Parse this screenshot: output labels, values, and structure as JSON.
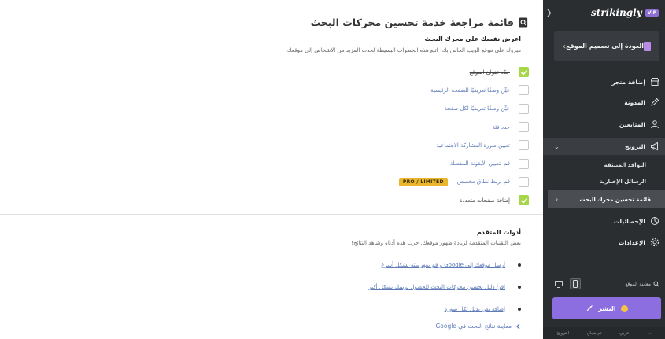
{
  "panel": {
    "title": "قائمة مراجعة خدمة تحسين محركات البحث",
    "intro_heading": "اعرض نفسك على محرك البحث",
    "intro_desc": "مبروك على موقع الويب الخاص بك! اتبع هذه الخطوات البسيطة لجذب المزيد من الأشخاص إلى موقعك.",
    "checklist": [
      {
        "label": "حدّد عنوان الموقع",
        "checked": true
      },
      {
        "label": "عيِّن وصفًا تعريفيًا للصفحة الرئيسية",
        "checked": false
      },
      {
        "label": "عيِّن وصفًا تعريفيًا لكل صفحة",
        "checked": false
      },
      {
        "label": "حدد فئة",
        "checked": false
      },
      {
        "label": "تعيين صورة المشاركة الاجتماعية",
        "checked": false
      },
      {
        "label": "قم بتعيين الأيقونة المفضلة",
        "checked": false
      },
      {
        "label": "قم بربط نطاق مخصص",
        "checked": false,
        "badge": "PRO / LIMITED"
      },
      {
        "label": "إضافة صفحات متعددة",
        "checked": true
      }
    ],
    "tools_heading": "أدوات المتقدم",
    "tools_desc": "بعض التقنيات المتقدمة لزيادة ظهور موقعك. جرب هذه أدناه وشاهد النتائج!",
    "tools": [
      "أرسل موقعك إلى Google و قم بفهرسته بشكل أسرع",
      "اقرأ دليل تحسين محركات البحث للحصول ترتيبك بشكل أكبر",
      "إضافة نص بديل لكل صورة"
    ],
    "preview_label": "معاينة نتائج البحث في Google"
  },
  "sidebar": {
    "logo": "strikingly",
    "vip": "VIP",
    "back_label": "العودة إلى تصميم الموقع",
    "nav": [
      {
        "label": "إضافة متجر",
        "icon": "store-icon"
      },
      {
        "label": "المدونة",
        "icon": "blog-icon"
      },
      {
        "label": "المتابعين",
        "icon": "followers-icon"
      },
      {
        "label": "الترويج",
        "icon": "megaphone-icon",
        "expanded": true
      }
    ],
    "sub_items": [
      "النوافذ المنبثقة",
      "الرسائل الإخبارية",
      "قائمة تحسين محرك البحث"
    ],
    "nav_after": [
      {
        "label": "الإحصائيات",
        "icon": "stats-icon"
      },
      {
        "label": "الإعدادات",
        "icon": "settings-icon"
      }
    ],
    "preview_label": "معاينة الموقع",
    "publish_label": "النشر",
    "bottom_tabs": [
      "الترويج",
      "تم بنجاح",
      "عربي",
      "..."
    ]
  },
  "colors": {
    "sidebar_bg": "#2a2e31",
    "accent_purple": "#8d6ee0",
    "check_green": "#a7d64b",
    "link_blue": "#5e7bb8",
    "badge_gold": "#e9b62e"
  }
}
